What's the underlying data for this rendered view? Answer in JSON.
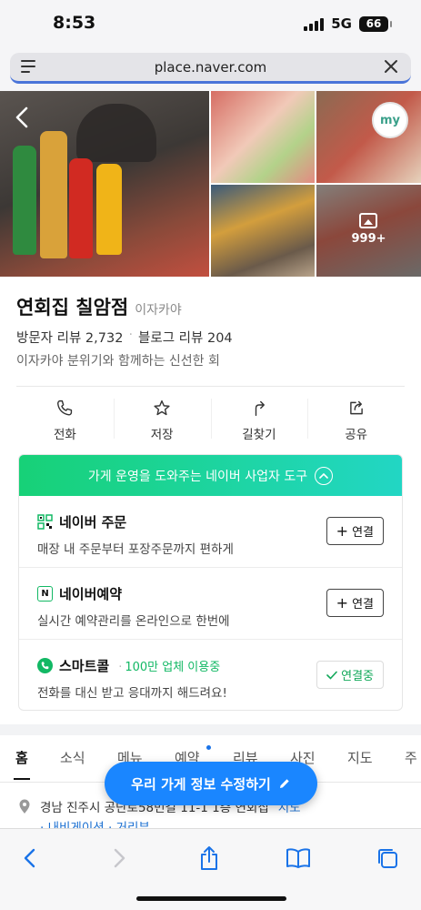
{
  "status_bar": {
    "time": "8:53",
    "network": "5G",
    "battery": "66"
  },
  "browser": {
    "url": "place.naver.com"
  },
  "gallery": {
    "more_count": "999+",
    "avatar_text": "my"
  },
  "place": {
    "name": "연회집 칠암점",
    "category": "이자카야",
    "visitor_reviews": "방문자 리뷰 2,732",
    "blog_reviews": "블로그 리뷰 204",
    "description": "이자카야 분위기와 함께하는 신선한 회"
  },
  "actions": [
    {
      "label": "전화",
      "icon": "phone-icon"
    },
    {
      "label": "저장",
      "icon": "star-icon"
    },
    {
      "label": "길찾기",
      "icon": "directions-icon"
    },
    {
      "label": "공유",
      "icon": "share-icon"
    }
  ],
  "biz_tools": {
    "header": "가게 운영을 도와주는 네이버 사업자 도구",
    "items": [
      {
        "title": "네이버 주문",
        "subtitle": "매장 내 주문부터 포장주문까지 편하게",
        "button": "연결",
        "icon": "qr-icon"
      },
      {
        "title": "네이버예약",
        "subtitle": "실시간 예약관리를 온라인으로 한번에",
        "button": "연결",
        "icon": "naver-n-icon"
      },
      {
        "title": "스마트콜",
        "extra": "100만 업체 이용중",
        "subtitle": "전화를 대신 받고 응대까지 해드려요!",
        "button": "연결중",
        "icon": "call-icon"
      }
    ]
  },
  "tabs": [
    "홈",
    "소식",
    "메뉴",
    "예약",
    "리뷰",
    "사진",
    "지도",
    "주"
  ],
  "address": {
    "text": "경남 진주시 공단로58번길 11-1 1층 연회집",
    "map_link": "지도",
    "nav_link": "내비게이션",
    "distance_link": "거리뷰"
  },
  "fab": {
    "label": "우리 가게 정보 수정하기"
  },
  "colors": {
    "accent_green": "#17d177",
    "fab_blue": "#1a86ff",
    "link_blue": "#1a6fd1"
  }
}
